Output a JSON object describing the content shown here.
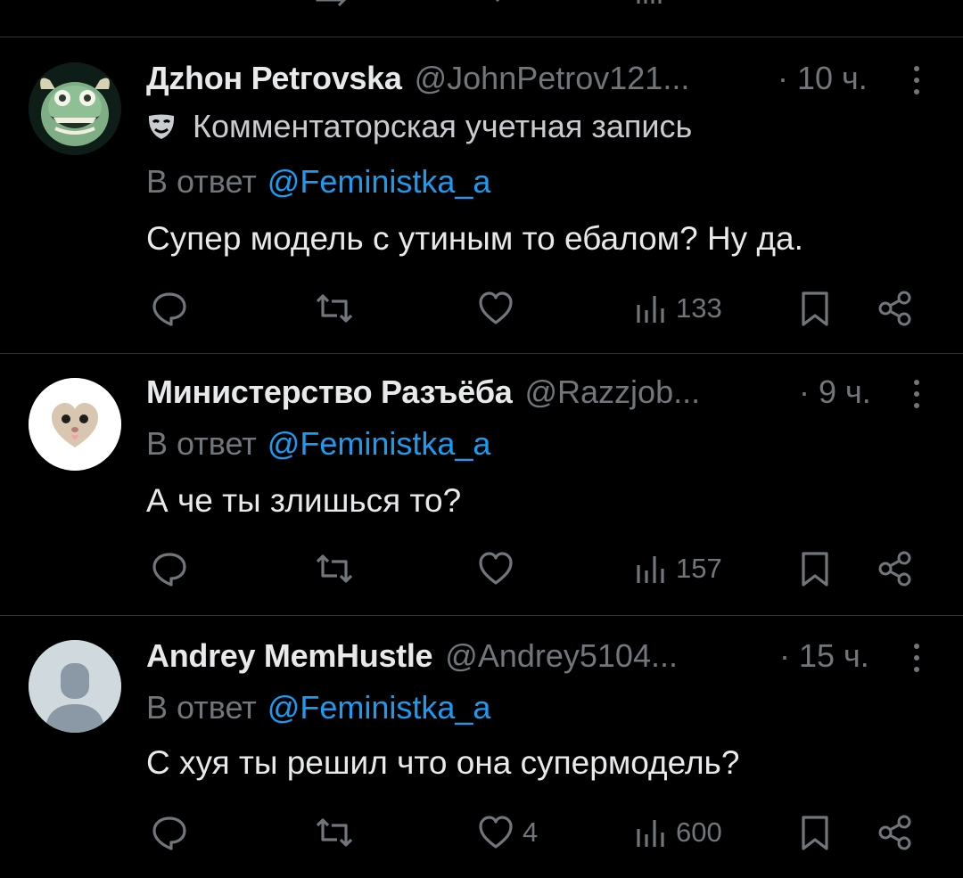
{
  "tweets": [
    {
      "name": "Дzhон Реtгоvskа",
      "handle": "@JohnPetrov121...",
      "time": "· 10 ч.",
      "badge": "Комментаторская учетная запись",
      "reply_prefix": "В ответ",
      "reply_to": "@Feministka_a",
      "text": "Супер модель с утиным то ебалом? Ну да.",
      "likes": "",
      "views": "133"
    },
    {
      "name": "Министерство Разъёба",
      "handle": "@Razzjob...",
      "time": "· 9 ч.",
      "reply_prefix": "В ответ",
      "reply_to": "@Feministka_a",
      "text": "А че ты злишься то?",
      "likes": "",
      "views": "157"
    },
    {
      "name": "Andrey MemHustle",
      "handle": "@Andrey5104...",
      "time": "· 15 ч.",
      "reply_prefix": "В ответ",
      "reply_to": "@Feministka_a",
      "text": "С хуя ты решил что она супермодель?",
      "likes": "4",
      "views": "600"
    }
  ],
  "colors": {
    "background": "#000000",
    "text": "#e7e9ea",
    "muted": "#71767b",
    "accent": "#1d9bf0",
    "divider": "#2f3336"
  }
}
